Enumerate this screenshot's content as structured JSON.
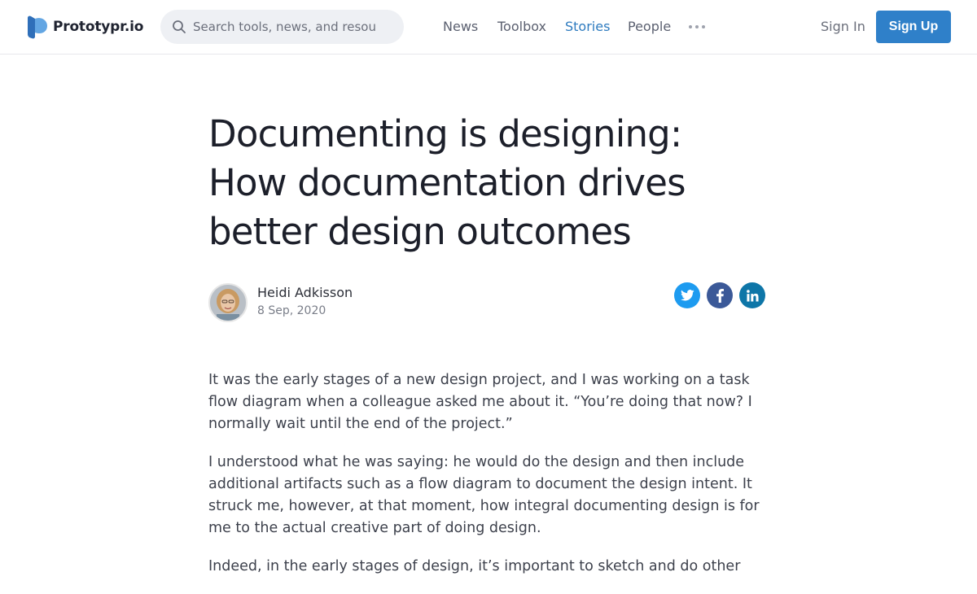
{
  "header": {
    "logo_text": "Prototypr.io",
    "search_placeholder": "Search tools, news, and resources",
    "nav": [
      "News",
      "Toolbox",
      "Stories",
      "People"
    ],
    "active_nav": "Stories",
    "signin_label": "Sign In",
    "signup_label": "Sign Up"
  },
  "article": {
    "title": "Documenting is designing: How documentation drives better design outcomes",
    "author": "Heidi Adkisson",
    "date": "8 Sep, 2020",
    "share": [
      "twitter-icon",
      "facebook-icon",
      "linkedin-icon"
    ],
    "paragraphs": [
      "It was the early stages of a new design project, and I was working on a task flow diagram when a colleague asked me about it. “You’re doing that now? I normally wait until the end of the project.”",
      "I understood what he was saying: he would do the design and then include additional artifacts such as a flow diagram to document the design intent. It struck me, however, at that moment, how integral documenting design is for me to the actual creative part of doing design.",
      "Indeed, in the early stages of design, it’s important to sketch and do other"
    ]
  },
  "colors": {
    "accent": "#2f80c9",
    "active_nav": "#2e7bbf",
    "twitter": "#1d9bf0",
    "facebook": "#3b5998",
    "linkedin": "#0e76a8"
  }
}
